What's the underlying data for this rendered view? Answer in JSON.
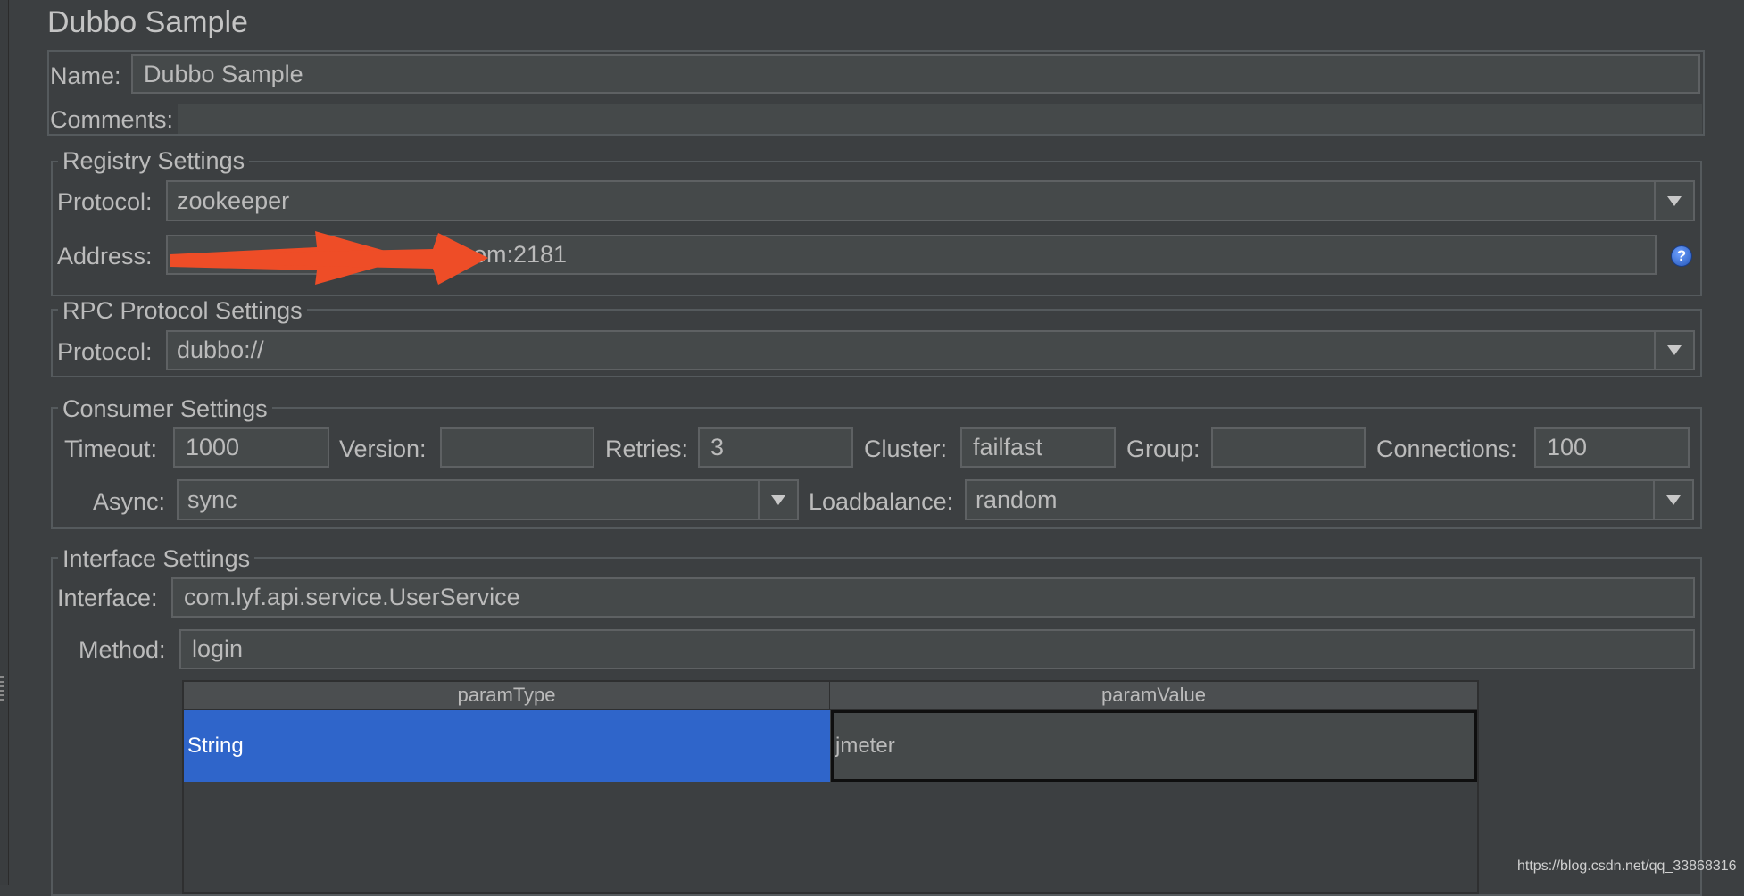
{
  "title": "Dubbo Sample",
  "name": {
    "label": "Name:",
    "value": "Dubbo Sample"
  },
  "comments": {
    "label": "Comments:",
    "value": ""
  },
  "registry": {
    "legend": "Registry Settings",
    "protocol_label": "Protocol:",
    "protocol_value": "zookeeper",
    "address_label": "Address:",
    "address_value": "om:2181",
    "help_glyph": "?"
  },
  "rpc": {
    "legend": "RPC Protocol Settings",
    "protocol_label": "Protocol:",
    "protocol_value": "dubbo://"
  },
  "consumer": {
    "legend": "Consumer Settings",
    "timeout_label": "Timeout:",
    "timeout_value": "1000",
    "version_label": "Version:",
    "version_value": "",
    "retries_label": "Retries:",
    "retries_value": "3",
    "cluster_label": "Cluster:",
    "cluster_value": "failfast",
    "group_label": "Group:",
    "group_value": "",
    "connections_label": "Connections:",
    "connections_value": "100",
    "async_label": "Async:",
    "async_value": "sync",
    "loadbalance_label": "Loadbalance:",
    "loadbalance_value": "random"
  },
  "interface": {
    "legend": "Interface Settings",
    "interface_label": "Interface:",
    "interface_value": "com.lyf.api.service.UserService",
    "method_label": "Method:",
    "method_value": "login"
  },
  "params_table": {
    "headers": [
      "paramType",
      "paramValue"
    ],
    "rows": [
      [
        "String",
        "jmeter"
      ]
    ]
  },
  "annotation": {
    "color": "#ee4d27"
  },
  "colors": {
    "background": "#3c3f41",
    "field": "#45494a",
    "selection": "#2f65ca"
  },
  "watermark": "https://blog.csdn.net/qq_33868316"
}
